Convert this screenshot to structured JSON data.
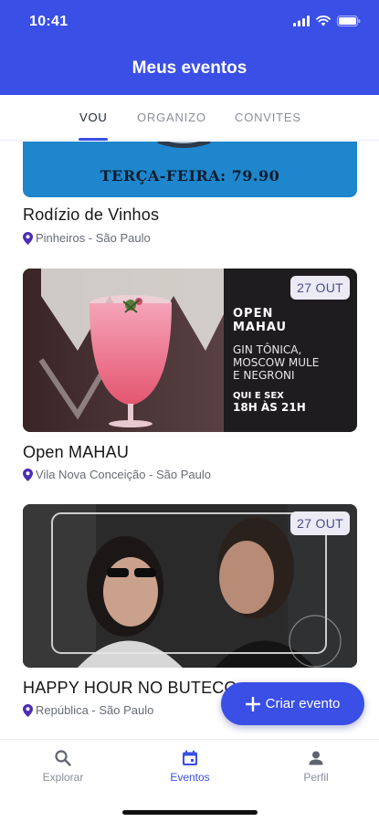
{
  "status_bar": {
    "time": "10:41"
  },
  "header": {
    "title": "Meus eventos"
  },
  "tabs": [
    {
      "label": "VOU",
      "active": true
    },
    {
      "label": "ORGANIZO",
      "active": false
    },
    {
      "label": "CONVITES",
      "active": false
    }
  ],
  "events": [
    {
      "banner_text": "TERÇA-FEIRA: 79.90",
      "name": "Rodízio de Vinhos",
      "location": "Pinheiros - São Paulo"
    },
    {
      "date_badge": "27 OUT",
      "poster": {
        "title_line1": "OPEN",
        "title_line2": "MAHAU",
        "drinks_line1": "GIN TÔNICA,",
        "drinks_line2": "MOSCOW MULE",
        "drinks_line3": "E NEGRONI",
        "days": "QUI E SEX",
        "hours": "18H ÀS 21H"
      },
      "name": "Open MAHAU",
      "location": "Vila Nova Conceição - São Paulo"
    },
    {
      "date_badge": "27 OUT",
      "name": "HAPPY HOUR NO BUTECO",
      "location": "República - São Paulo"
    }
  ],
  "fab": {
    "label": "Criar evento",
    "icon": "plus-icon"
  },
  "bottom_nav": [
    {
      "label": "Explorar",
      "icon": "search-icon",
      "active": false
    },
    {
      "label": "Eventos",
      "icon": "calendar-icon",
      "active": true
    },
    {
      "label": "Perfil",
      "icon": "person-icon",
      "active": false
    }
  ],
  "colors": {
    "primary": "#3a4fe6",
    "banner_blue": "#1d86cc",
    "poster_dark": "#1e1c1e",
    "location_pin": "#4a2fb5"
  }
}
